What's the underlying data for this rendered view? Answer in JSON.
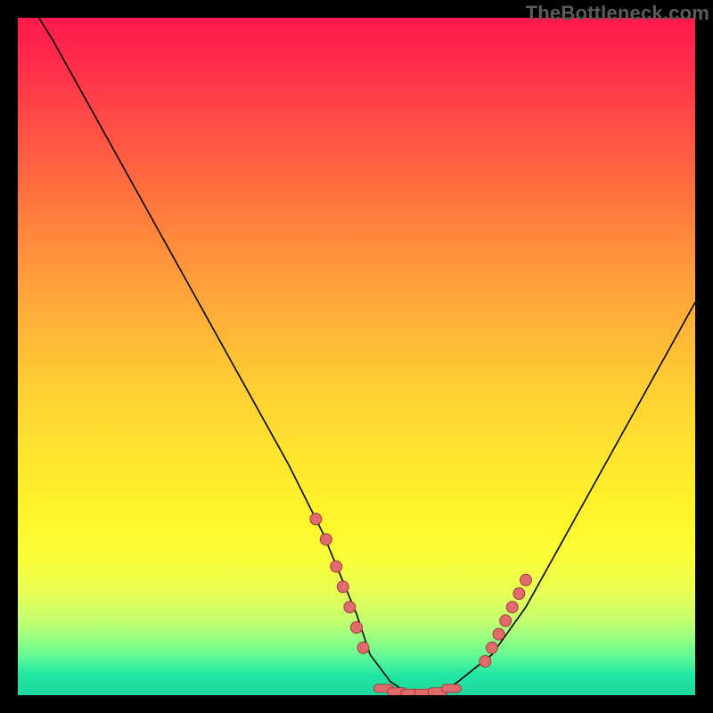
{
  "watermark": "TheBottleneck.com",
  "colors": {
    "background": "#000000",
    "gradient_top": "#ff1a4d",
    "gradient_mid": "#ffd233",
    "gradient_bottom": "#1fd7a0",
    "curve": "#000000",
    "marker_fill": "#e16a6a",
    "marker_stroke": "#9e3e3e"
  },
  "chart_data": {
    "type": "line",
    "title": "",
    "xlabel": "",
    "ylabel": "",
    "xlim": [
      0,
      100
    ],
    "ylim": [
      0,
      100
    ],
    "x": [
      0,
      5,
      10,
      15,
      20,
      25,
      30,
      35,
      40,
      45,
      50,
      52,
      55,
      58,
      60,
      62,
      65,
      70,
      75,
      80,
      85,
      90,
      95,
      100
    ],
    "values": [
      105,
      97,
      88,
      79,
      70,
      61,
      52,
      43,
      34,
      24,
      12,
      6,
      2,
      0,
      0,
      0,
      2,
      6,
      13,
      22,
      31,
      40,
      49,
      58
    ],
    "markers": {
      "left_cluster_x": [
        44,
        45.5,
        47,
        48,
        49,
        50,
        51
      ],
      "left_cluster_y": [
        26,
        23,
        19,
        16,
        13,
        10,
        7
      ],
      "bottom_cluster_x": [
        54,
        56,
        58,
        60,
        62,
        64
      ],
      "bottom_cluster_y": [
        1,
        0.5,
        0.3,
        0.3,
        0.5,
        1
      ],
      "right_cluster_x": [
        69,
        70,
        71,
        72,
        73,
        74,
        75
      ],
      "right_cluster_y": [
        5,
        7,
        9,
        11,
        13,
        15,
        17
      ]
    },
    "notes": "V-shaped bottleneck curve on vertical rainbow gradient; minimum near x≈60; salmon dot clusters along both descending/ascending portions and along the flat bottom."
  }
}
